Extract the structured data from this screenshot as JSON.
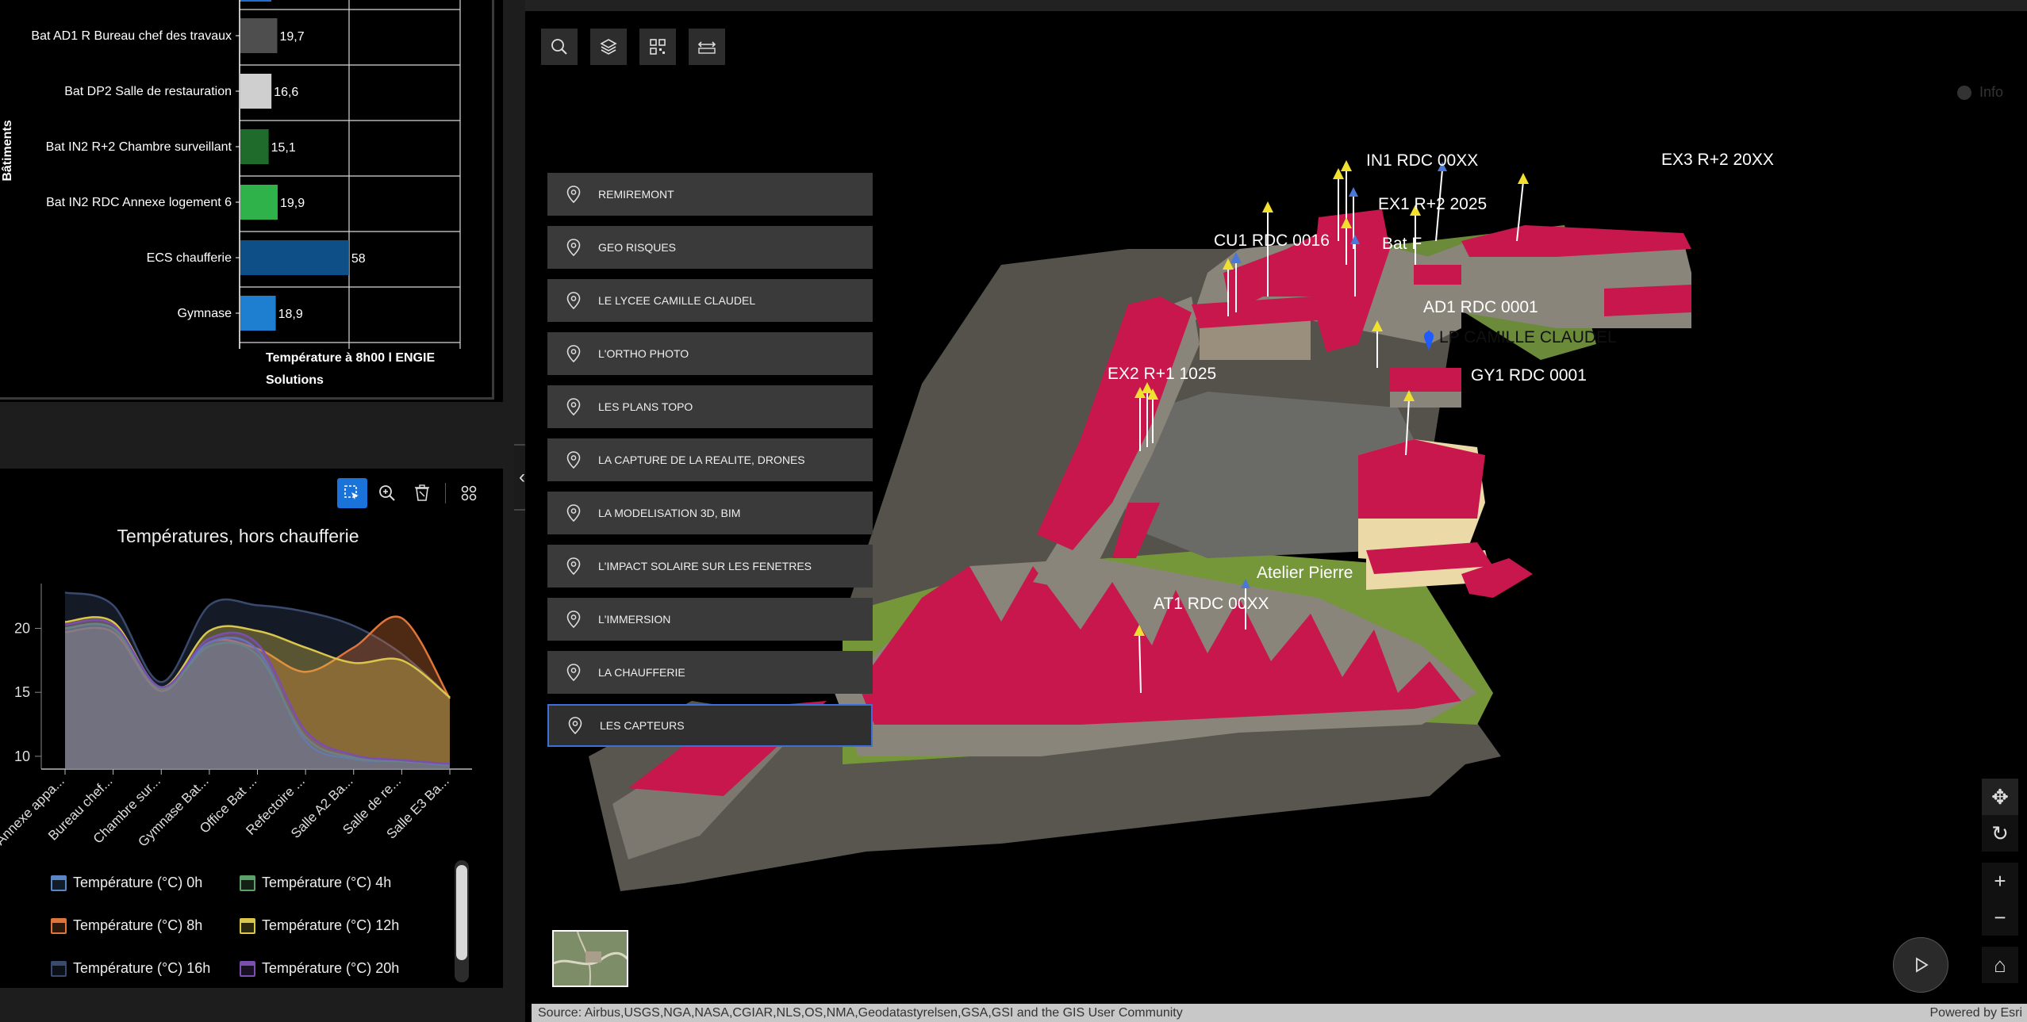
{
  "bar_chart": {
    "type": "bar",
    "orientation": "horizontal",
    "y_axis_title": "Bâtiments",
    "x_axis_title_line1": "Température à 8h00 l ENGIE",
    "x_axis_title_line2": "Solutions",
    "categories": [
      "Bat AD1 R Bureau chef des travaux",
      "Bat DP2 Salle de restauration",
      "Bat IN2 R+2 Chambre surveillant",
      "Bat IN2 RDC Annexe logement 6",
      "ECS chaufferie",
      "Gymnase"
    ],
    "values": [
      19.7,
      16.6,
      15.1,
      19.9,
      58,
      18.9
    ],
    "value_labels": [
      "19,7",
      "16,6",
      "15,1",
      "19,9",
      "58",
      "18,9"
    ],
    "colors": [
      "#4e4e4e",
      "#cfcfcf",
      "#1f6b2c",
      "#2fb24a",
      "#0d4f86",
      "#1e7fd0"
    ],
    "top_bar_color": "#1e6fd0"
  },
  "area_chart": {
    "title": "Températures, hors chaufferie",
    "toolbar": [
      "select-icon",
      "zoom-icon",
      "clear-selection-icon",
      "apps-icon"
    ],
    "chart_data": {
      "type": "area",
      "categories": [
        "Annexe appa...",
        "Bureau chef...",
        "Chambre sur...",
        "Gymnase Bat...",
        "Office Bat ...",
        "Refectoire ...",
        "Salle A2 Ba...",
        "Salle de re...",
        "Salle E3 Ba..."
      ],
      "y_ticks": [
        "10",
        "15",
        "20"
      ],
      "ylim": [
        9,
        23.5
      ],
      "series": [
        {
          "name": "Température (°C) 0h",
          "color": "#5a86c6",
          "values": [
            20,
            20,
            15.3,
            18.9,
            18.3,
            11.2,
            9.8,
            9.6,
            9.3
          ]
        },
        {
          "name": "Température (°C) 4h",
          "color": "#5fa06a",
          "values": [
            20,
            20,
            15.3,
            18.6,
            17.9,
            11.5,
            9.9,
            9.6,
            9.4
          ]
        },
        {
          "name": "Température (°C) 8h",
          "color": "#e0753a",
          "values": [
            19.7,
            19.7,
            15.1,
            18.9,
            18.4,
            16.6,
            18.5,
            20.8,
            14.5
          ]
        },
        {
          "name": "Température (°C) 12h",
          "color": "#d9c64a",
          "values": [
            20.5,
            20.5,
            15.4,
            19.8,
            19.8,
            18.5,
            17.3,
            17.5,
            14.6
          ]
        },
        {
          "name": "Température (°C) 16h",
          "color": "#3a4a6e",
          "values": [
            22.8,
            21.8,
            15.8,
            21.8,
            21.8,
            21.3,
            20.2,
            18,
            14.6
          ]
        },
        {
          "name": "Température (°C) 20h",
          "color": "#7a4fb0",
          "values": [
            20.3,
            20.3,
            15.4,
            19.2,
            18.8,
            12,
            10.1,
            9.7,
            9.4
          ]
        }
      ]
    }
  },
  "map": {
    "toolbar": [
      "search-icon",
      "layers-icon",
      "qr-code-icon",
      "measure-icon"
    ],
    "info_label": "Info",
    "bookmarks": [
      "REMIREMONT",
      "GEO RISQUES",
      "LE LYCEE CAMILLE CLAUDEL",
      "L'ORTHO PHOTO",
      "LES PLANS TOPO",
      "LA CAPTURE DE LA REALITE, DRONES",
      "LA MODELISATION 3D, BIM",
      "L'IMPACT SOLAIRE SUR LES FENETRES",
      "L'IMMERSION",
      "LA CHAUFFERIE",
      "LES CAPTEURS"
    ],
    "active_bookmark": "LES CAPTEURS",
    "scene_labels": {
      "in1": "IN1 RDC 00XX",
      "ex3": "EX3 R+2 20XX",
      "ex1": "EX1 R+2 2025",
      "batf": "Bat F",
      "cu1": "CU1 RDC 0016",
      "ad1": "AD1 RDC 0001",
      "lp": "LP CAMILLE CLAUDEL",
      "gy1": "GY1 RDC 0001",
      "ex2": "EX2 R+1 1025",
      "atelier": "Atelier Pierre",
      "at1": "AT1 RDC 00XX"
    },
    "attribution": "Source: Airbus,USGS,NGA,NASA,CGIAR,NLS,OS,NMA,Geodatastyrelsen,GSA,GSI and the GIS User Community",
    "powered_by": "Powered by Esri",
    "nav": {
      "pan": "✥",
      "rotate": "↻",
      "zoom_in": "+",
      "zoom_out": "−",
      "home": "⌂"
    },
    "colors": {
      "roof": "#c8174c",
      "wall": "#8a857a",
      "grass": "#7da83a"
    }
  }
}
